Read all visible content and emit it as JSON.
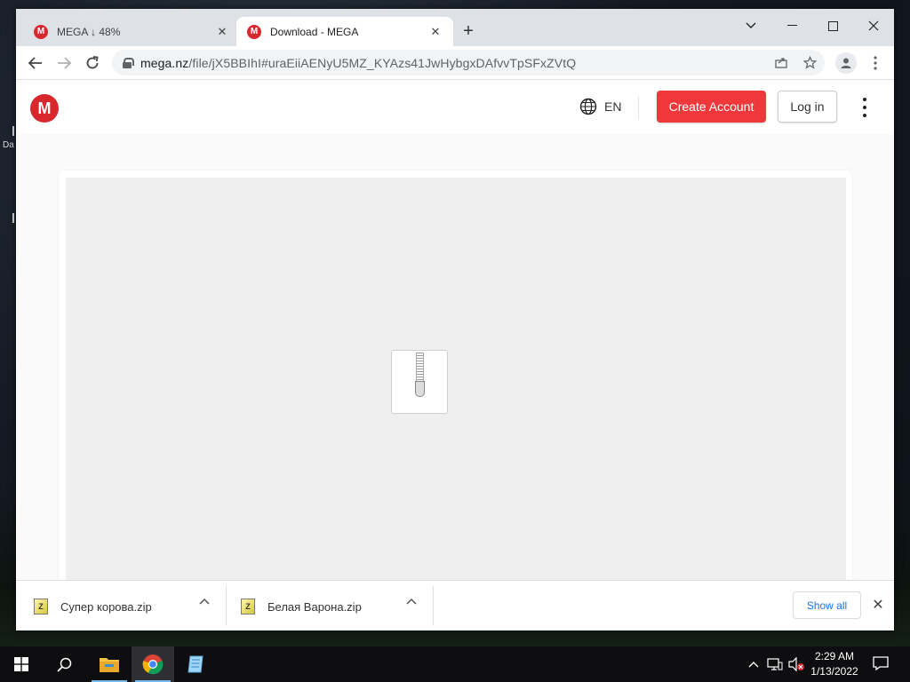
{
  "desktop": {
    "label": "Da"
  },
  "browser": {
    "tabs": [
      {
        "title": "MEGA ↓ 48%",
        "favicon": "M",
        "close": "✕"
      },
      {
        "title": "Download - MEGA",
        "favicon": "M",
        "close": "✕"
      }
    ],
    "new_tab": "+",
    "window_controls": {
      "dropdown": "⌄",
      "minimize": "—",
      "maximize": "☐",
      "close": "✕"
    },
    "url_host": "mega.nz",
    "url_rest": "/file/jX5BBIhI#uraEiiAENyU5MZ_KYAzs41JwHybgxDAfvvTpSFxZVtQ"
  },
  "mega": {
    "logo": "M",
    "language": "EN",
    "create_account": "Create Account",
    "login": "Log in"
  },
  "downloads": {
    "items": [
      {
        "name": "Супер корова.zip",
        "icon": "Z"
      },
      {
        "name": "Белая Варона.zip",
        "icon": "Z"
      }
    ],
    "show_all": "Show all",
    "close": "✕"
  },
  "taskbar": {
    "time": "2:29 AM",
    "date": "1/13/2022"
  },
  "colors": {
    "mega_red": "#d9272e",
    "create_button": "#f0373a",
    "link_blue": "#1a73e8"
  }
}
